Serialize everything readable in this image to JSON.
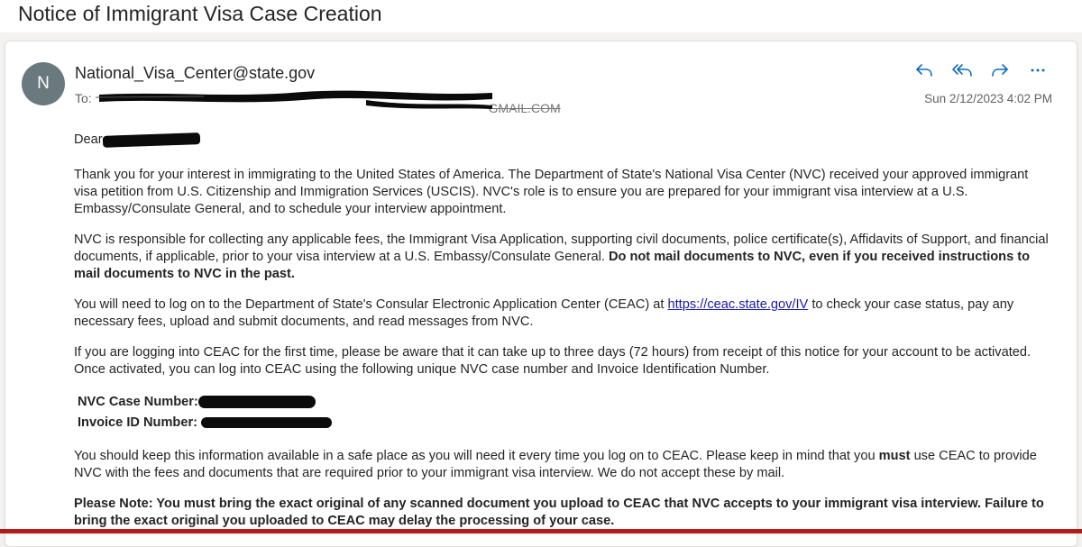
{
  "subject": "Notice of Immigrant Visa Case Creation",
  "message": {
    "avatar_initial": "N",
    "from": "National_Visa_Center@state.gov",
    "to_label": "To:",
    "to_visible_tail": "GMAIL.COM",
    "date": "Sun 2/12/2023 4:02 PM",
    "actions": {
      "reply_icon": "reply-icon",
      "reply_all_icon": "reply-all-icon",
      "forward_icon": "forward-icon",
      "more_icon": "more-icon"
    }
  },
  "body": {
    "greeting": "Dear",
    "p1": "Thank you for your interest in immigrating to the United States of America. The Department of State's National Visa Center (NVC) received your approved immigrant visa petition from U.S. Citizenship and Immigration Services (USCIS). NVC's role is to ensure you are prepared for your immigrant visa interview at a U.S. Embassy/Consulate General, and to schedule your interview appointment.",
    "p2_text": "NVC is responsible for collecting any applicable fees, the Immigrant Visa Application, supporting civil documents, police certificate(s), Affidavits of Support, and financial documents, if applicable, prior to your visa interview at a U.S. Embassy/Consulate General. ",
    "p2_bold": "Do not mail documents to NVC, even if you received instructions to mail documents to NVC in the past.",
    "p3_before": "You will need to log on to the Department of State's Consular Electronic Application Center (CEAC) at ",
    "p3_link": "https://ceac.state.gov/IV",
    "p3_after": " to check your case status, pay any necessary fees, upload and submit documents, and read messages from NVC.",
    "p4": "If you are logging into CEAC for the first time, please be aware that it can take up to three days (72 hours) from receipt of this notice for your account to be activated. Once activated, you can log into CEAC using the following unique NVC case number and Invoice Identification Number.",
    "case_number_label": "NVC Case Number:",
    "invoice_id_label": "Invoice ID Number:",
    "p5_before": "You should keep this information available in a safe place as you will need it every time you log on to CEAC. Please keep in mind that you ",
    "p5_bold": "must",
    "p5_after": " use CEAC to provide NVC with the fees and documents that are required prior to your immigrant visa interview. We do not accept these by mail.",
    "p6": "Please Note: You must bring the exact original of any scanned document you upload to CEAC that NVC accepts to your immigrant visa interview. Failure to bring the exact original you uploaded to CEAC may delay the processing of your case."
  },
  "colors": {
    "avatar_bg": "#69797e",
    "accent": "#0f6cbd",
    "link": "#1a1aa6",
    "bottom_strip": "#b31b1b"
  }
}
